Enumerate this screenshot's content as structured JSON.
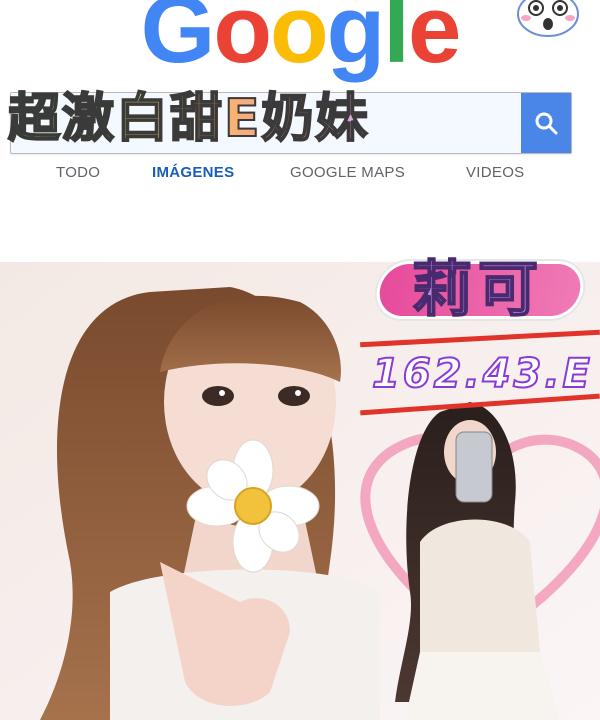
{
  "header": {
    "logo_text": "Google",
    "logo_colors": [
      "#4285F4",
      "#EA4335",
      "#FBBC05",
      "#4285F4",
      "#34A853",
      "#EA4335"
    ]
  },
  "overlay": {
    "headline": "超激白甜E奶妹",
    "name": "莉可",
    "stats": "162.43.E"
  },
  "search": {
    "button_icon": "search-icon",
    "button_color": "#4a86e8"
  },
  "tabs": [
    {
      "label": "TODO",
      "active": false
    },
    {
      "label": "IMÁGENES",
      "active": true
    },
    {
      "label": "GOOGLE MAPS",
      "active": false
    },
    {
      "label": "VIDEOS",
      "active": false
    }
  ],
  "colors": {
    "active_tab": "#1a5fb4",
    "tab": "#5f6368",
    "accent_pink": "#e64b9b",
    "accent_red": "#e0342b",
    "accent_purple": "#8a3ad6"
  }
}
